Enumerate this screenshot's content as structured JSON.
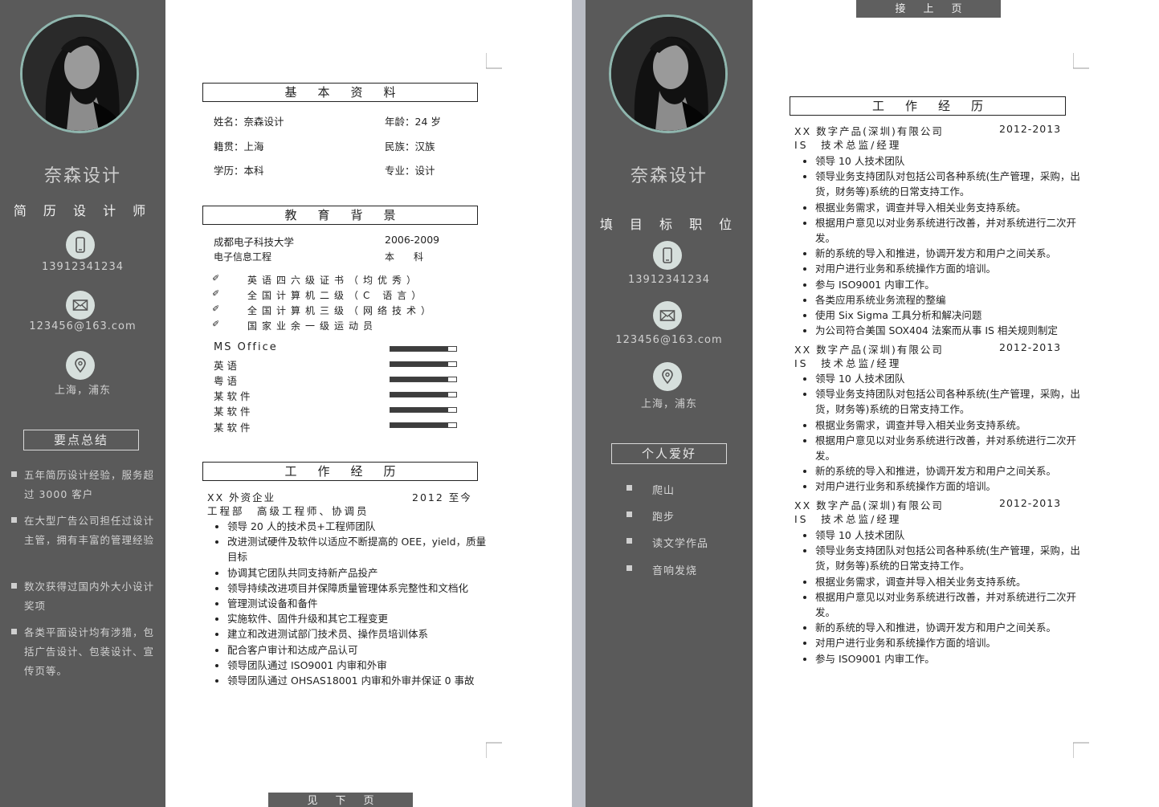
{
  "profile": {
    "name": "奈森设计",
    "phone": "13912341234",
    "email": "123456@163.com",
    "location": "上海，浦东"
  },
  "page1": {
    "title": "简 历 设 计 师",
    "summary_title": "要点总结",
    "summary": [
      "五年简历设计经验，服务超过 3000 客户",
      "在大型广告公司担任过设计主管，拥有丰富的管理经验",
      "数次获得过国内外大小设计奖项",
      "各类平面设计均有涉猎，包括广告设计、包装设计、宣传页等。"
    ],
    "basic": {
      "title": "基本资料",
      "name_label": "姓名：",
      "name_value": "奈森设计",
      "age_label": "年龄：",
      "age_value": "24 岁",
      "origin_label": "籍贯：",
      "origin_value": "上海",
      "ethnic_label": "民族：",
      "ethnic_value": "汉族",
      "edu_label": "学历：",
      "edu_value": "本科",
      "major_label": "专业：",
      "major_value": "设计"
    },
    "education": {
      "title": "教育背景",
      "school": "成都电子科技大学",
      "years": "2006-2009",
      "major": "电子信息工程",
      "degree": "本　　科",
      "certs": [
        "英语四六级证书（均优秀）",
        "全国计算机二级（C 语言）",
        "全国计算机三级（网络技术）",
        "国家业余一级运动员"
      ],
      "skills": [
        {
          "name": "MS  Office",
          "level": 0.88
        },
        {
          "name": "英语",
          "level": 0.88
        },
        {
          "name": "粤语",
          "level": 0.88
        },
        {
          "name": "某软件",
          "level": 0.88
        },
        {
          "name": "某软件",
          "level": 0.88
        },
        {
          "name": "某软件",
          "level": 0.88
        }
      ]
    },
    "work": {
      "title": "工作经历",
      "company": "XX 外资企业",
      "period": "2012 至今",
      "position": "工程部　高级工程师、协调员",
      "items": [
        "领导 20 人的技术员+工程师团队",
        "改进测试硬件及软件以适应不断提高的 OEE，yield，质量目标",
        "协调其它团队共同支持新产品投产",
        "领导持续改进项目并保障质量管理体系完整性和文档化",
        "管理测试设备和备件",
        "实施软件、固件升级和其它工程变更",
        "建立和改进测试部门技术员、操作员培训体系",
        "配合客户审计和达成产品认可",
        "领导团队通过 ISO9001 内审和外审",
        "领导团队通过 OHSAS18001 内审和外审并保证 0 事故"
      ]
    },
    "next_tab": "见下页"
  },
  "page2": {
    "title": "填 目 标 职 位",
    "prev_tab": "接上页",
    "hobby_title": "个人爱好",
    "hobbies": [
      "爬山",
      "跑步",
      "读文学作品",
      "音响发烧"
    ],
    "work": {
      "title": "工作经历",
      "jobs": [
        {
          "company": "XX 数字产品(深圳)有限公司",
          "period": "2012-2013",
          "position": "IS　技术总监/经理",
          "items": [
            "领导 10 人技术团队",
            "领导业务支持团队对包括公司各种系统(生产管理，采购，出货，财务等)系统的日常支持工作。",
            "根据业务需求，调查并导入相关业务支持系统。",
            "根据用户意见以对业务系统进行改善，并对系统进行二次开发。",
            "新的系统的导入和推进，协调开发方和用户之间关系。",
            "对用户进行业务和系统操作方面的培训。",
            "参与 ISO9001 内审工作。",
            "各类应用系统业务流程的整编",
            "使用 Six Sigma 工具分析和解决问题",
            "为公司符合美国 SOX404 法案而从事 IS 相关规则制定"
          ]
        },
        {
          "company": "XX 数字产品(深圳)有限公司",
          "period": "2012-2013",
          "position": "IS　技术总监/经理",
          "items": [
            "领导 10 人技术团队",
            "领导业务支持团队对包括公司各种系统(生产管理，采购，出货，财务等)系统的日常支持工作。",
            "根据业务需求，调查并导入相关业务支持系统。",
            "根据用户意见以对业务系统进行改善，并对系统进行二次开发。",
            "新的系统的导入和推进，协调开发方和用户之间关系。",
            "对用户进行业务和系统操作方面的培训。"
          ]
        },
        {
          "company": "XX 数字产品(深圳)有限公司",
          "period": "2012-2013",
          "position": "IS　技术总监/经理",
          "items": [
            "领导 10 人技术团队",
            "领导业务支持团队对包括公司各种系统(生产管理，采购，出货，财务等)系统的日常支持工作。",
            "根据业务需求，调查并导入相关业务支持系统。",
            "根据用户意见以对业务系统进行改善，并对系统进行二次开发。",
            "新的系统的导入和推进，协调开发方和用户之间关系。",
            "对用户进行业务和系统操作方面的培训。",
            "参与 ISO9001 内审工作。"
          ]
        }
      ]
    }
  }
}
